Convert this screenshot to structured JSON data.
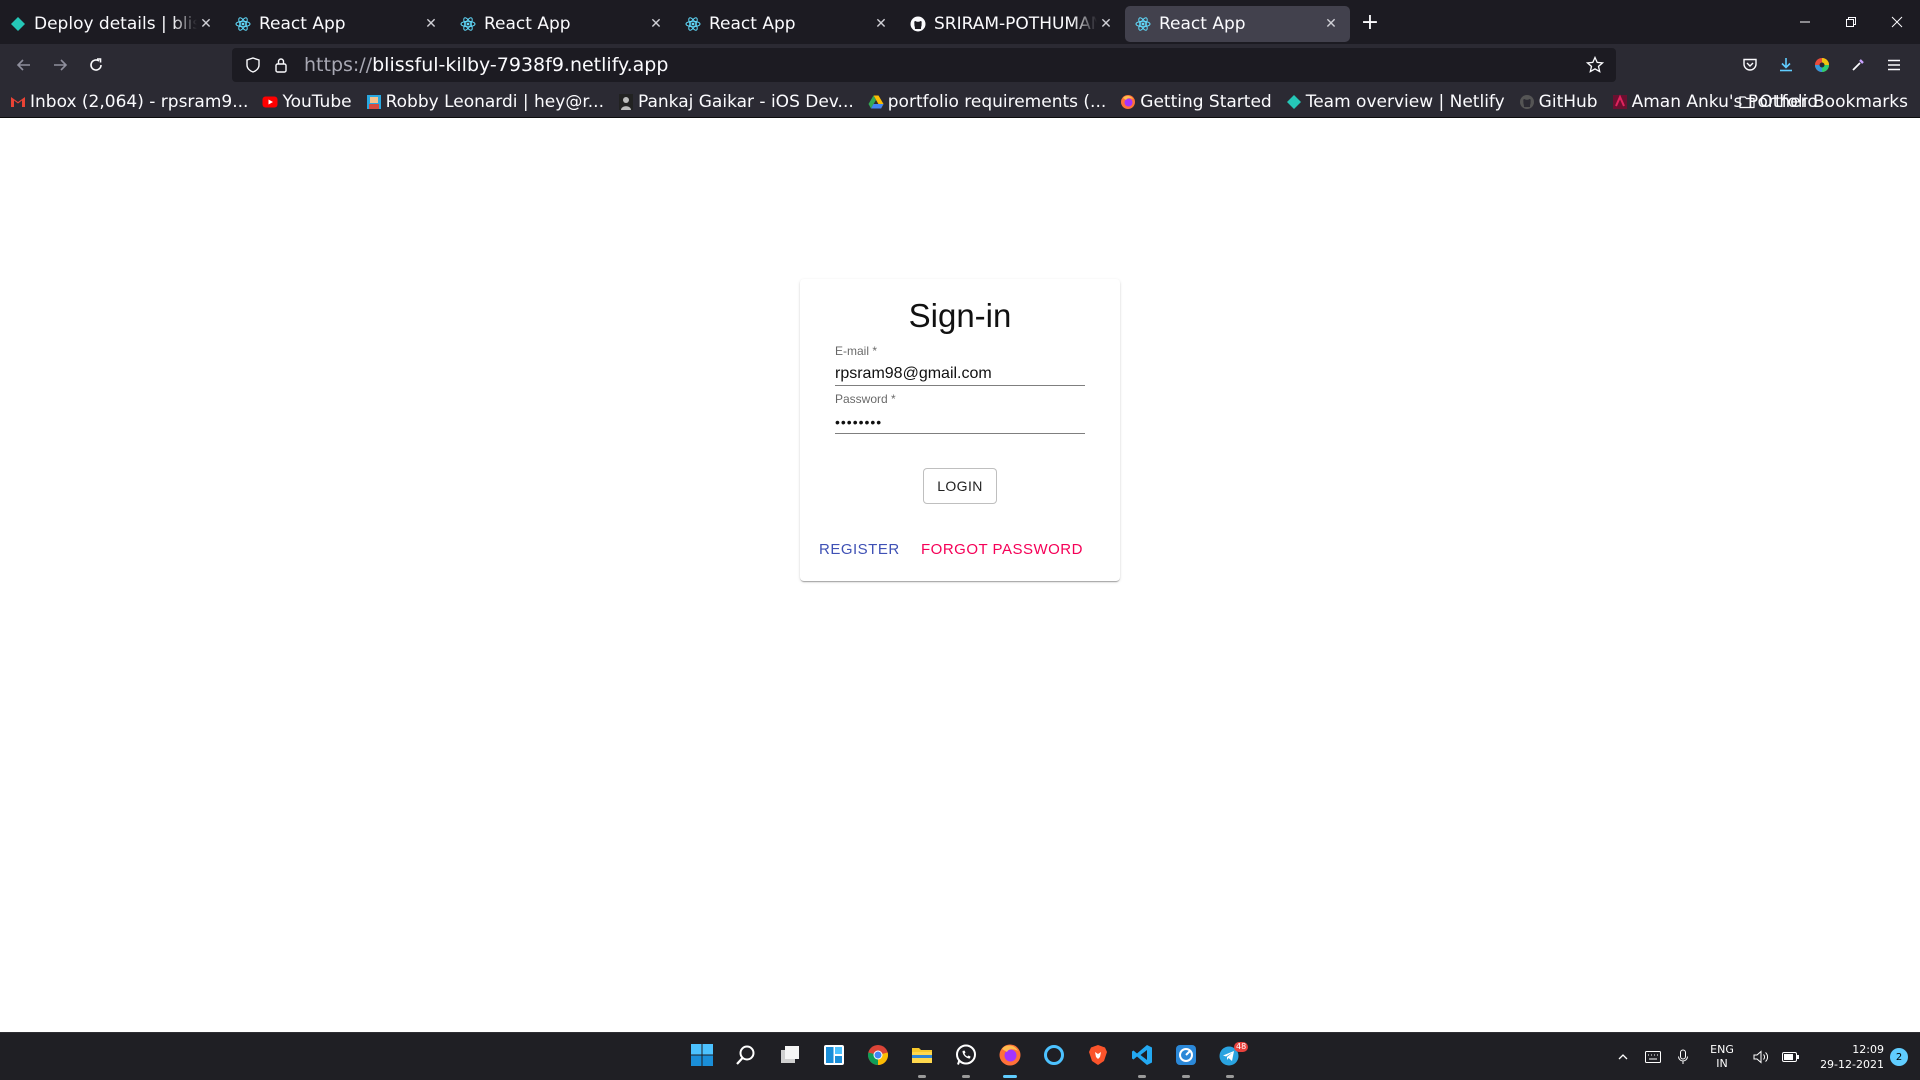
{
  "browser": {
    "tabs": [
      {
        "title": "Deploy details | blissful-kilby",
        "icon": "netlify-icon",
        "active": false
      },
      {
        "title": "React App",
        "icon": "react-icon",
        "active": false
      },
      {
        "title": "React App",
        "icon": "react-icon",
        "active": false
      },
      {
        "title": "React App",
        "icon": "react-icon",
        "active": false
      },
      {
        "title": "SRIRAM-POTHUMANI",
        "icon": "github-icon",
        "active": false
      },
      {
        "title": "React App",
        "icon": "react-icon",
        "active": true
      }
    ],
    "url": {
      "scheme": "https://",
      "host": "blissful-kilby-7938f9.netlify.app"
    },
    "bookmarks": [
      {
        "label": "Inbox (2,064) - rpsram9...",
        "icon": "gmail-icon",
        "color": "#ea4335"
      },
      {
        "label": "YouTube",
        "icon": "youtube-icon",
        "color": "#ff0000"
      },
      {
        "label": "Robby Leonardi | hey@r...",
        "icon": "robby-icon",
        "color": "#29a8e0"
      },
      {
        "label": "Pankaj Gaikar - iOS Dev...",
        "icon": "avatar-icon",
        "color": "#444444"
      },
      {
        "label": "portfolio requirements (...",
        "icon": "google-drive-icon",
        "color": "#34a853"
      },
      {
        "label": "Getting Started",
        "icon": "firefox-icon",
        "color": "#ff7139"
      },
      {
        "label": "Team overview | Netlify",
        "icon": "netlify-icon",
        "color": "#25c7b7"
      },
      {
        "label": "GitHub",
        "icon": "github-icon",
        "color": "#444444"
      },
      {
        "label": "Aman Anku's Portfolio",
        "icon": "portfolio-icon",
        "color": "#e0245e"
      }
    ],
    "other_bookmarks": "Other Bookmarks"
  },
  "signin": {
    "title": "Sign-in",
    "email_label": "E-mail *",
    "email_value": "rpsram98@gmail.com",
    "password_label": "Password *",
    "password_value": "••••••••",
    "login_label": "LOGIN",
    "register_label": "REGISTER",
    "forgot_label": "FORGOT PASSWORD"
  },
  "taskbar": {
    "lang_line1": "ENG",
    "lang_line2": "IN",
    "time": "12:09",
    "date": "29-12-2021",
    "notification_count": "2",
    "telegram_badge": "48"
  }
}
